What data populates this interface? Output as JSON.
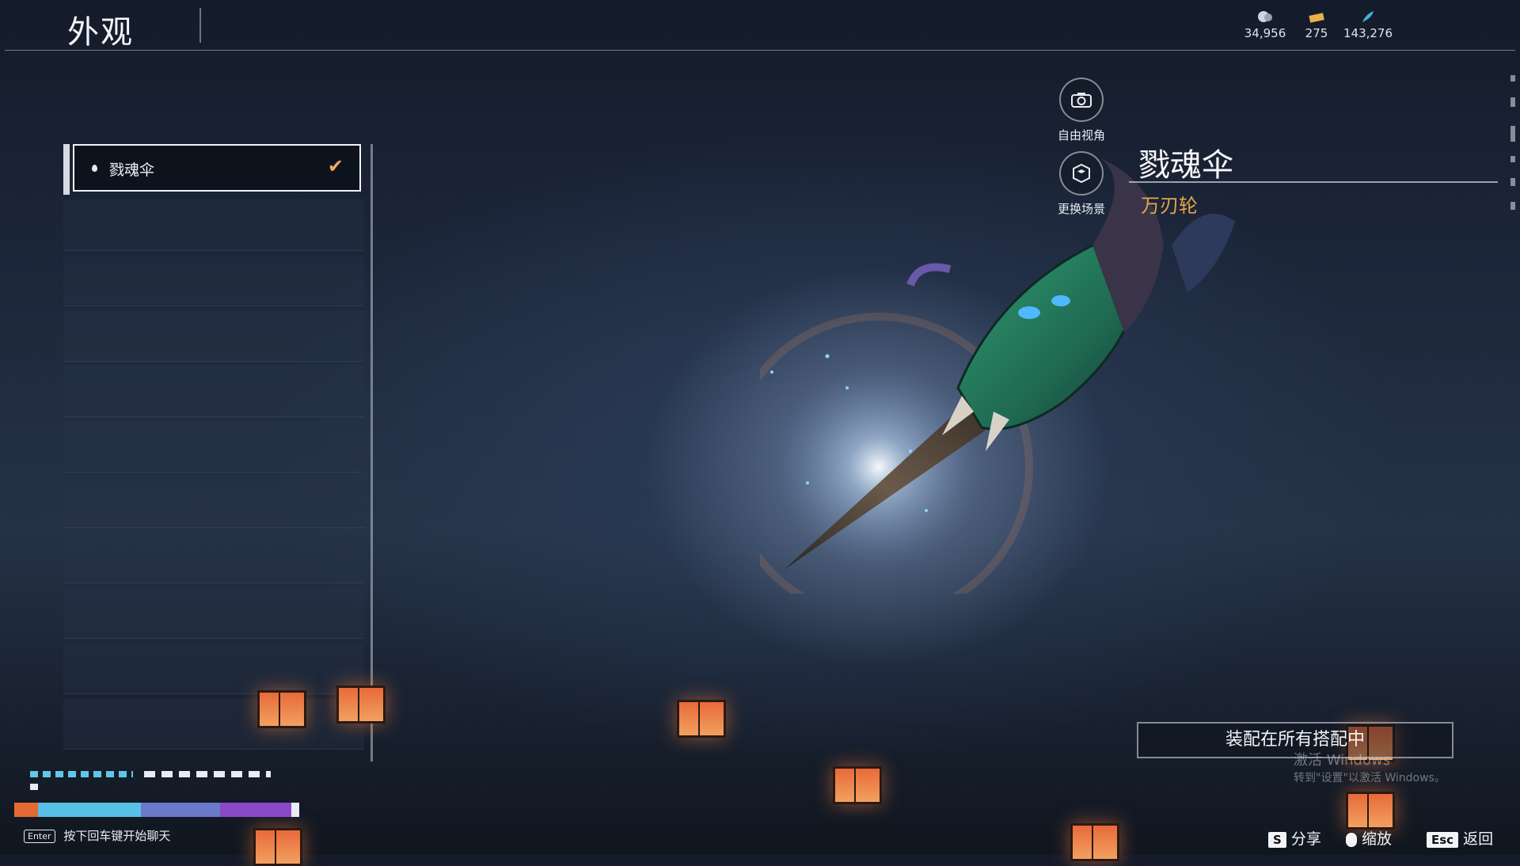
{
  "header": {
    "title": "外观",
    "currencies": [
      {
        "icon": "coin-icon",
        "value": "34,956"
      },
      {
        "icon": "ticket-icon",
        "value": "275"
      },
      {
        "icon": "feather-icon",
        "value": "143,276"
      }
    ]
  },
  "skin_list": {
    "items": [
      {
        "label": "戮魂伞",
        "selected": true
      }
    ]
  },
  "tools": {
    "free_view": "自由视角",
    "change_scene": "更换场景"
  },
  "detail": {
    "name": "戮魂伞",
    "weapon_type": "万刃轮"
  },
  "equip_button": "装配在所有搭配中",
  "windows_watermark": {
    "line1": "激活 Windows",
    "line2": "转到\"设置\"以激活 Windows。"
  },
  "chat": {
    "key": "Enter",
    "hint": "按下回车键开始聊天"
  },
  "footer_hints": [
    {
      "key": "S",
      "label": "分享"
    },
    {
      "key": "mouse-icon",
      "label": "缩放"
    },
    {
      "key": "Esc",
      "label": "返回"
    }
  ],
  "colors": {
    "accent_orange": "#f0a860",
    "subtitle_gold": "#e3a64a",
    "background_navy": "#1c2639"
  }
}
